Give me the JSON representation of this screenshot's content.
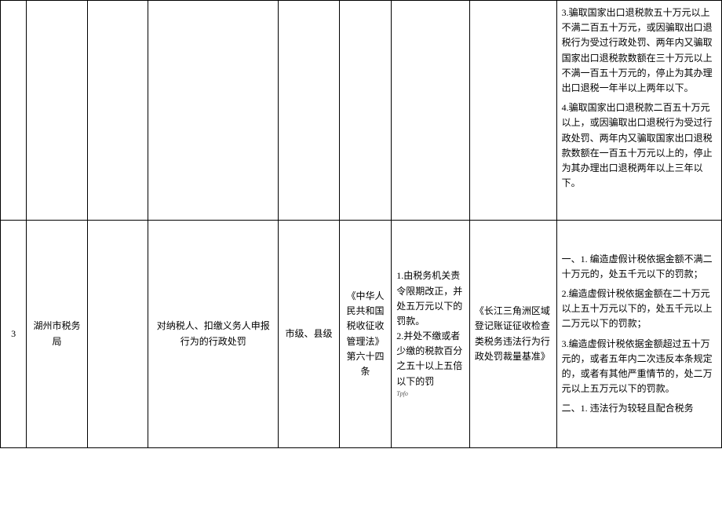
{
  "row1": {
    "criteria_p1": "3.骗取国家出口退税款五十万元以上不满二百五十万元，或因骗取出口退税行为受过行政处罚、两年内又骗取国家出口退税款数额在三十万元以上不满一百五十万元的，停止为其办理出口退税一年半以上两年以下。",
    "criteria_p2": "4.骗取国家出口退税款二百五十万元以上，或因骗取出口退税行为受过行政处罚、两年内又骗取国家出口退税款数额在一百五十万元以上的，停止为其办理出口退税两年以上三年以下。"
  },
  "row2": {
    "index": "3",
    "organ": "湖州市税务局",
    "matter": "对纳税人、扣缴义务人申报行为的行政处罚",
    "level": "市级、县级",
    "law": "《中华人民共和国税收征收管理法》第六十四条",
    "detail": "1.由税务机关责令限期改正，并处五万元以下的罚款。\n2.并处不缴或者少缴的税款百分之五十以上五倍以下的罚",
    "detail_note": "Tpfo",
    "reference": "《长江三角洲区域登记账证征收检查类税务违法行为行政处罚裁量基准》",
    "criteria_p1": "一、1. 编造虚假计税依据金额不满二十万元的，处五千元以下的罚款；",
    "criteria_p2": "2.编造虚假计税依据金额在二十万元以上五十万元以下的，处五千元以上二万元以下的罚款；",
    "criteria_p3": "3.编造虚假计税依据金额超过五十万元的，或者五年内二次违反本条规定的，或者有其他严重情节的，处二万元以上五万元以下的罚款。",
    "criteria_p4": "二、1. 违法行为较轻且配合税务"
  }
}
